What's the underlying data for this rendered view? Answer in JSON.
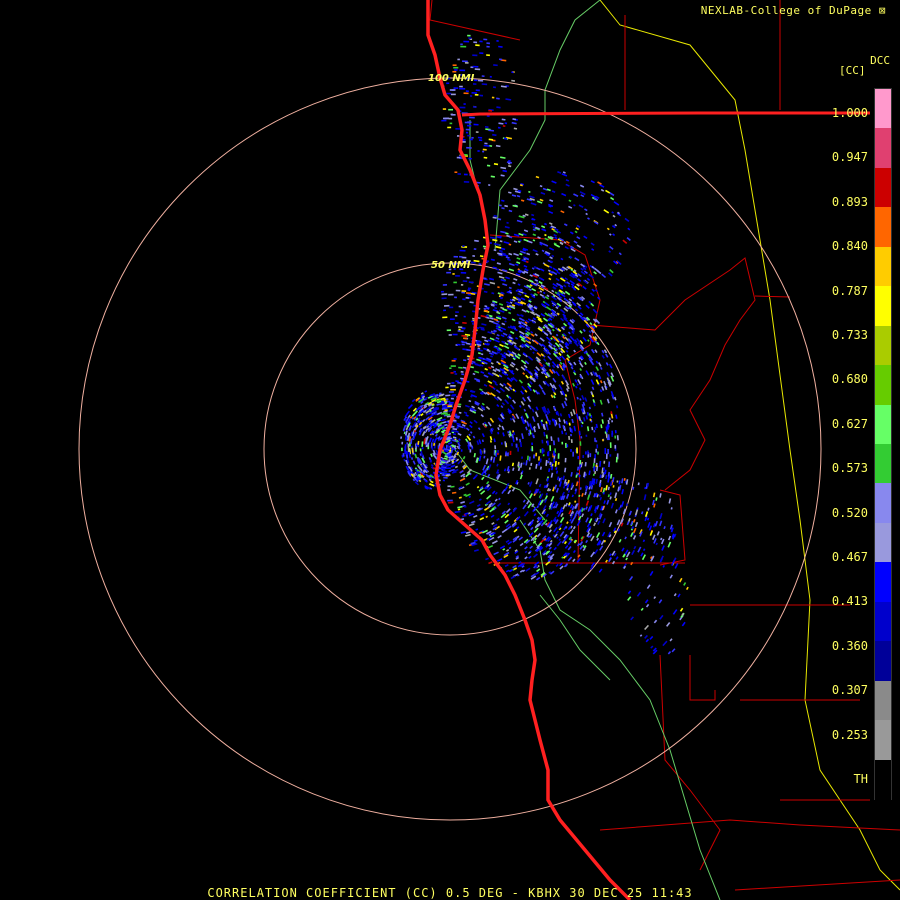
{
  "header": {
    "credit": "NEXLAB-College of DuPage",
    "product_code": "DCC",
    "product_unit": "[CC]"
  },
  "footer": {
    "title": "CORRELATION COEFFICIENT (CC) 0.5 DEG - KBHX 30 DEC 25 11:43"
  },
  "map": {
    "range_rings": [
      {
        "label": "50 NMI"
      },
      {
        "label": "100 NMI"
      }
    ],
    "colors": {
      "ring": "#f0b0a0",
      "coast": "#ff2020",
      "county": "#cc0000",
      "state": "#e8e800",
      "road": "#66cc66"
    }
  },
  "legend": {
    "ticks": [
      "1.000",
      "0.947",
      "0.893",
      "0.840",
      "0.787",
      "0.733",
      "0.680",
      "0.627",
      "0.573",
      "0.520",
      "0.467",
      "0.413",
      "0.360",
      "0.307",
      "0.253",
      "TH"
    ],
    "color_stops": [
      "#ff99cc",
      "#e04070",
      "#cc0000",
      "#ff6600",
      "#ffcc00",
      "#ffff00",
      "#aacc00",
      "#66cc00",
      "#66ff66",
      "#33cc33",
      "#8888ee",
      "#9999dd",
      "#0000ff",
      "#0000cc",
      "#000099",
      "#8a8a8a",
      "#999999",
      "#000000"
    ]
  }
}
